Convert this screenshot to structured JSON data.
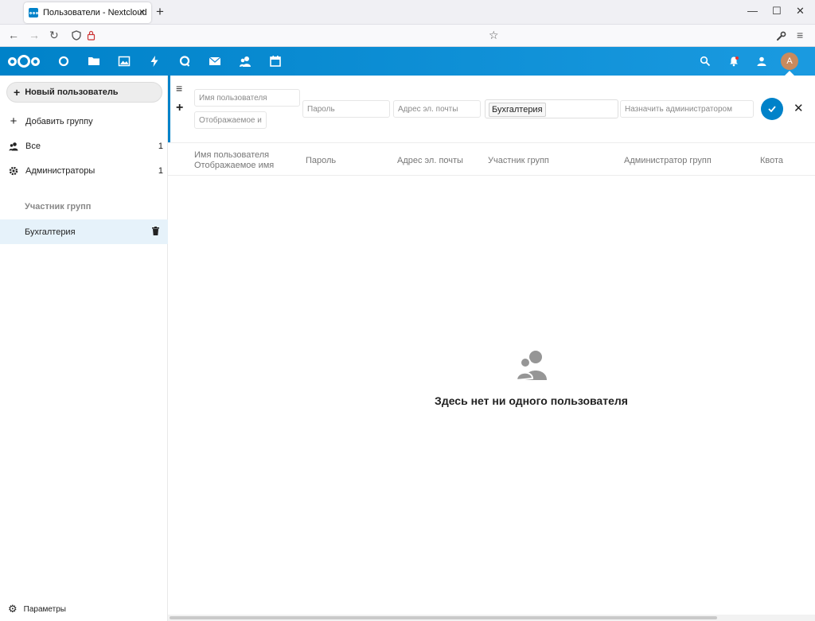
{
  "browser": {
    "tab_title": "Пользователи - Nextcloud",
    "tab_close": "×",
    "new_tab": "+",
    "window_controls": [
      "—",
      "☐",
      "✕"
    ]
  },
  "header": {
    "apps": [
      "dashboard",
      "files",
      "photos",
      "activity",
      "talk",
      "mail",
      "contacts",
      "calendar"
    ],
    "avatar_initial": "A",
    "accent_color": "#0082c9"
  },
  "sidebar": {
    "new_user_label": "Новый пользователь",
    "add_group_label": "Добавить группу",
    "groups": [
      {
        "label": "Все",
        "count": "1"
      },
      {
        "label": "Администраторы",
        "count": "1"
      }
    ],
    "caption": "Участник групп",
    "user_groups": [
      {
        "label": "Бухгалтерия"
      }
    ],
    "settings_label": "Параметры"
  },
  "new_user_form": {
    "username_placeholder": "Имя пользователя",
    "displayname_placeholder": "Отображаемое имя",
    "password_placeholder": "Пароль",
    "email_placeholder": "Адрес эл. почты",
    "selected_group": "Бухгалтерия",
    "admin_placeholder": "Назначить администратором"
  },
  "table": {
    "col_username": "Имя пользователя",
    "col_displayname": "Отображаемое имя",
    "col_password": "Пароль",
    "col_email": "Адрес эл. почты",
    "col_groups": "Участник групп",
    "col_admin": "Администратор групп",
    "col_quota": "Квота"
  },
  "empty_state": {
    "message": "Здесь нет ни одного пользователя"
  }
}
